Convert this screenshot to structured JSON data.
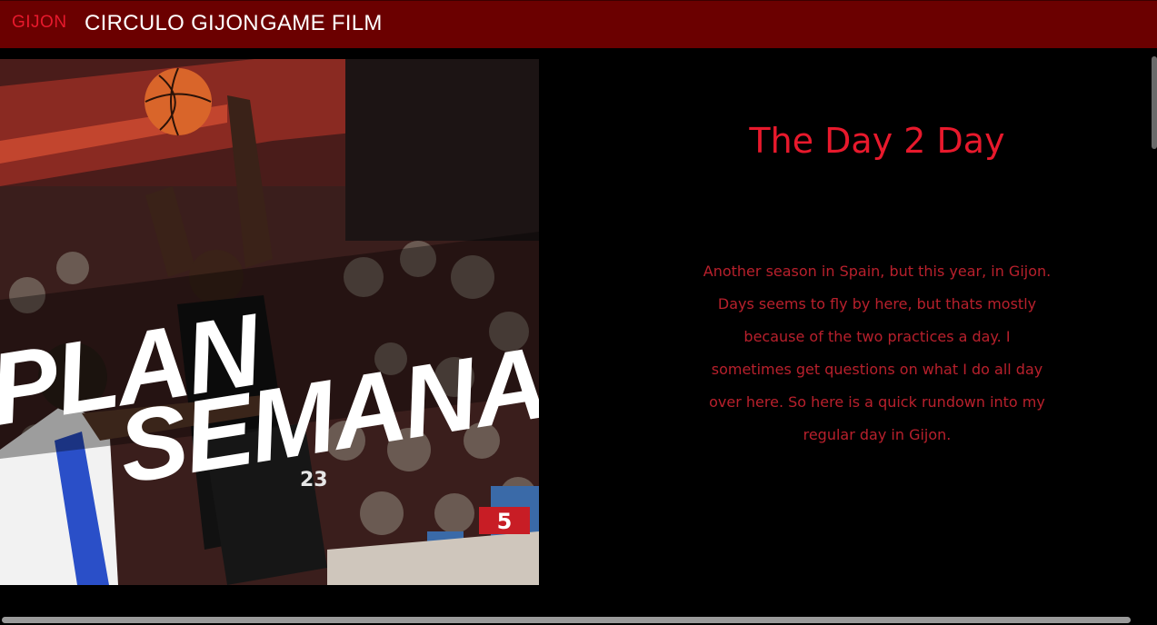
{
  "nav": {
    "brand": "GIJON",
    "links": [
      "CIRCULO GIJON",
      "GAME FILM"
    ]
  },
  "hero": {
    "overlay_line1": "PLAN",
    "overlay_line2": "SEMANAL",
    "jersey_number": "23",
    "sign_number": "5"
  },
  "article": {
    "title": "The Day 2 Day",
    "body": "Another season in Spain, but this year, in Gijon. Days seems to fly by here, but thats mostly because of the two practices a day. I sometimes get questions on what I do all day over here. So here is a quick rundown into my regular day in Gijon."
  },
  "colors": {
    "nav_bg": "#6b0000",
    "accent": "#e8192c",
    "body_text": "#b8202c",
    "page_bg": "#000000"
  },
  "icons": {
    "scrollbar_vertical": "vertical-scrollbar-thumb",
    "scrollbar_horizontal": "horizontal-scrollbar-thumb"
  }
}
